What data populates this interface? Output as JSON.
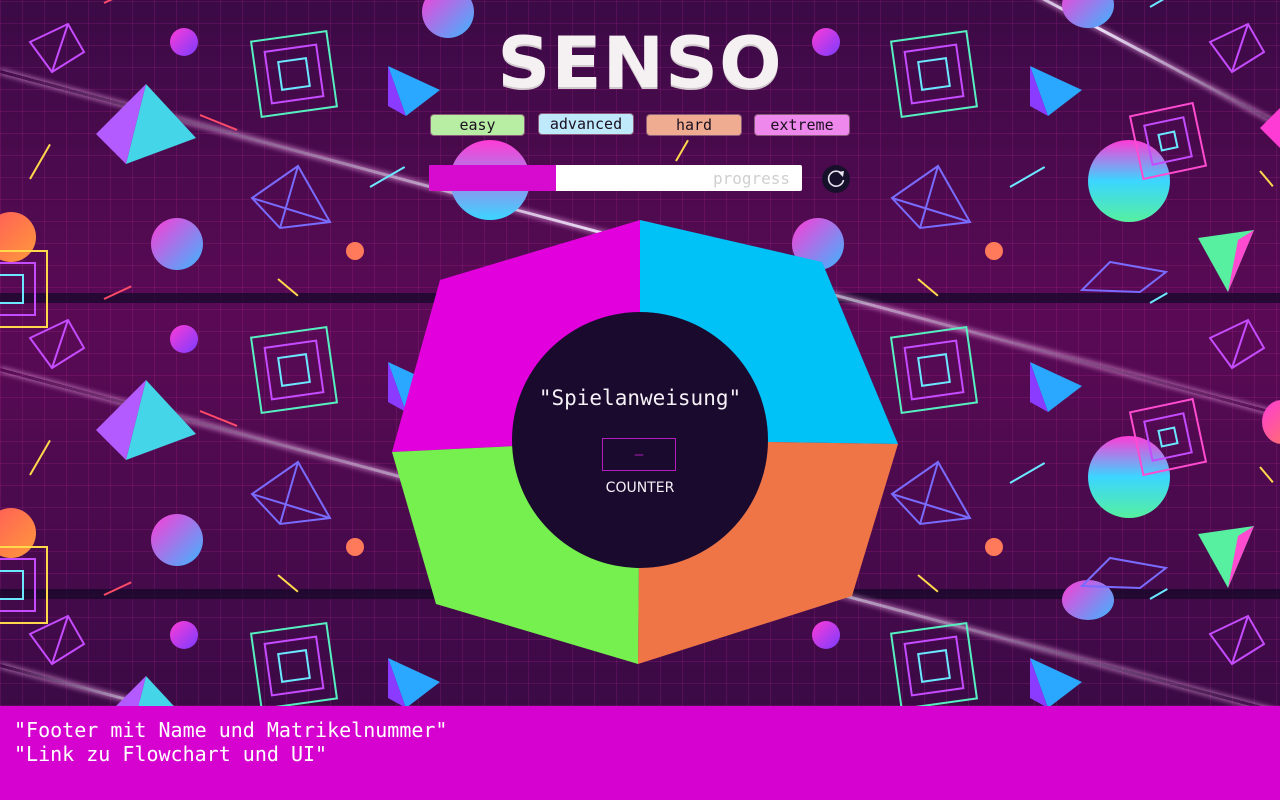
{
  "app": {
    "title": "SENSO"
  },
  "difficulty": {
    "easy": "easy",
    "advanced": "advanced",
    "hard": "hard",
    "extreme": "extreme"
  },
  "progress": {
    "label": "progress",
    "value_percent": 34
  },
  "reset": {
    "icon": "refresh-icon"
  },
  "board": {
    "instruction": "\"Spielanweisung\"",
    "counter_value": "–",
    "counter_label": "COUNTER",
    "segments": [
      {
        "name": "magenta",
        "color": "#e200dc"
      },
      {
        "name": "cyan",
        "color": "#00c2f7"
      },
      {
        "name": "orange",
        "color": "#ef7547"
      },
      {
        "name": "green",
        "color": "#76f04e"
      }
    ]
  },
  "footer": {
    "line1": "\"Footer mit Name und Matrikelnummer\"",
    "line2": "\"Link zu Flowchart und UI\""
  }
}
